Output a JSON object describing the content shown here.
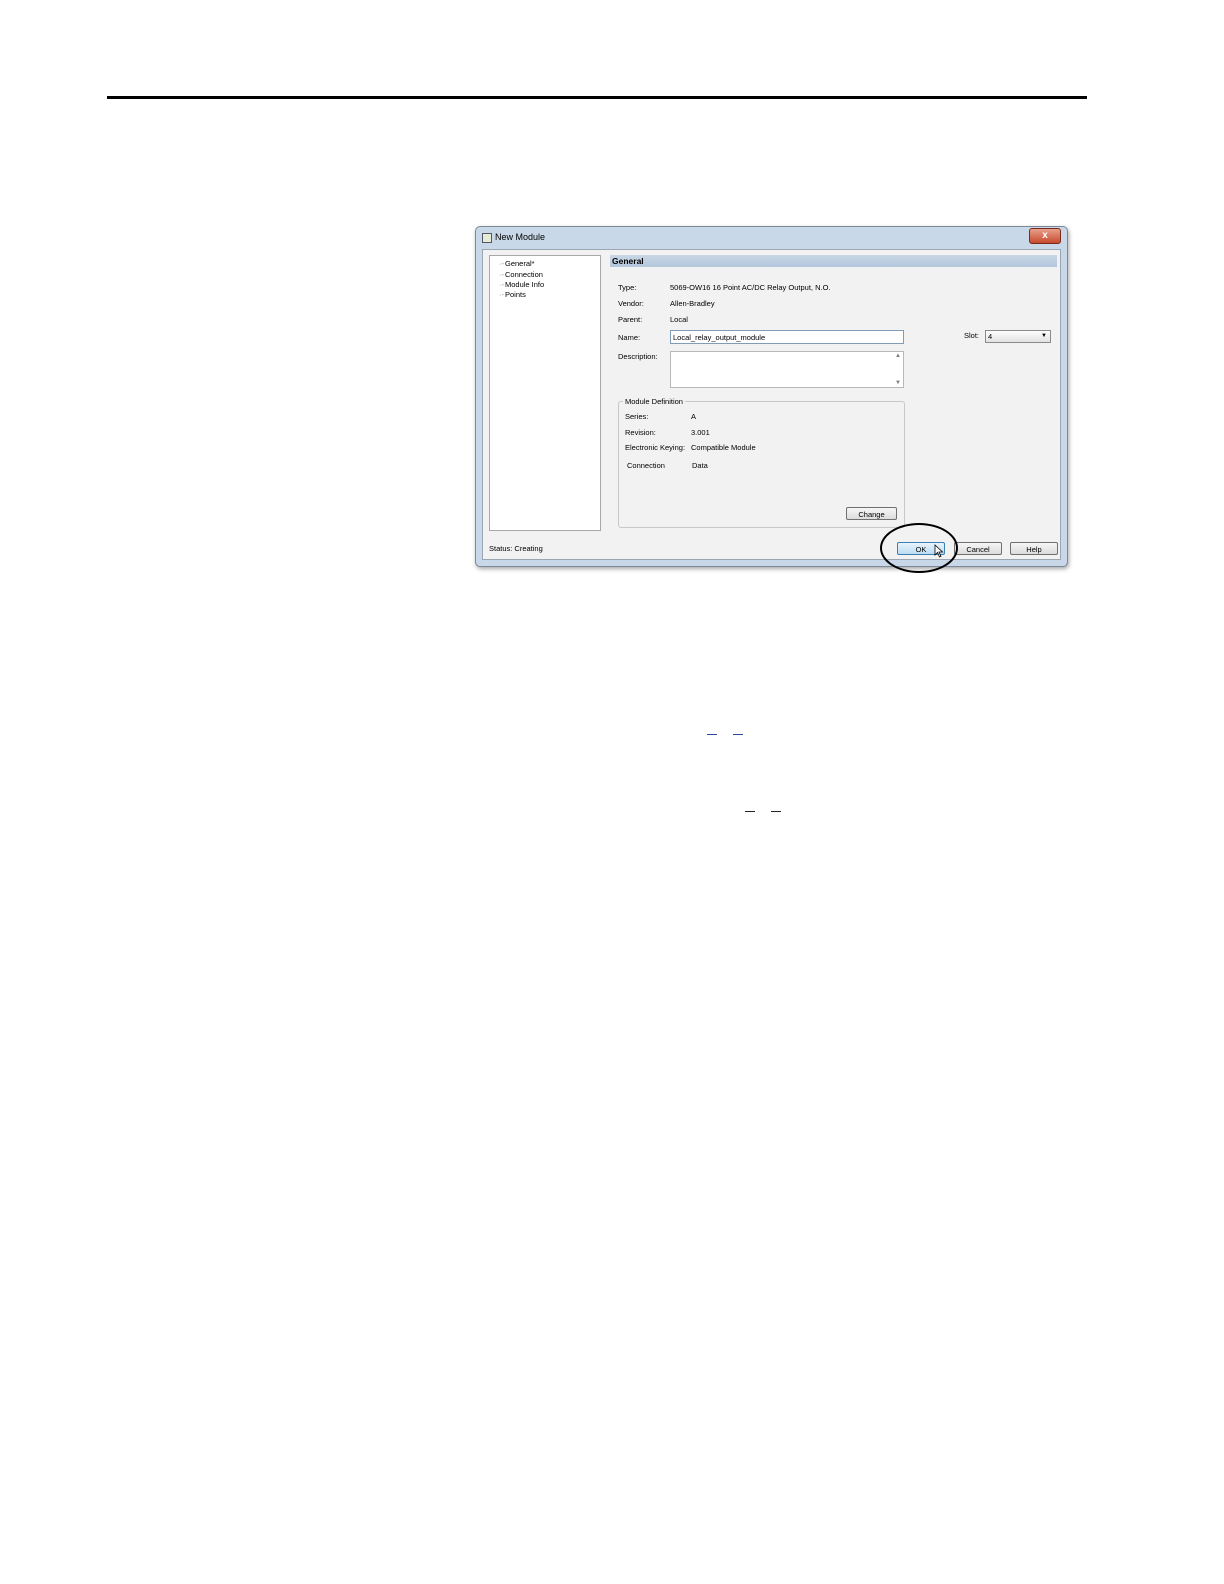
{
  "dialog": {
    "title": "New Module",
    "close_glyph": "x",
    "tree": [
      "General*",
      "Connection",
      "Module Info",
      "Points"
    ],
    "section_title": "General",
    "fields": {
      "type_label": "Type:",
      "type_value": "5069-OW16 16 Point AC/DC Relay Output, N.O.",
      "vendor_label": "Vendor:",
      "vendor_value": "Allen-Bradley",
      "parent_label": "Parent:",
      "parent_value": "Local",
      "name_label": "Name:",
      "name_value": "Local_relay_output_module",
      "description_label": "Description:",
      "slot_label": "Slot:",
      "slot_value": "4"
    },
    "module_definition": {
      "legend": "Module Definition",
      "series_label": "Series:",
      "series_value": "A",
      "revision_label": "Revision:",
      "revision_value": "3.001",
      "keying_label": "Electronic Keying:",
      "keying_value": "Compatible Module",
      "connection_label": "Connection",
      "connection_value": "Data",
      "change_label": "Change"
    },
    "status": "Status:  Creating",
    "buttons": {
      "ok": "OK",
      "cancel": "Cancel",
      "help": "Help"
    }
  },
  "colors": {
    "title_bar": "#c9d8e8",
    "close_button": "#c64a2e",
    "ok_button": "#bcdcf4"
  }
}
